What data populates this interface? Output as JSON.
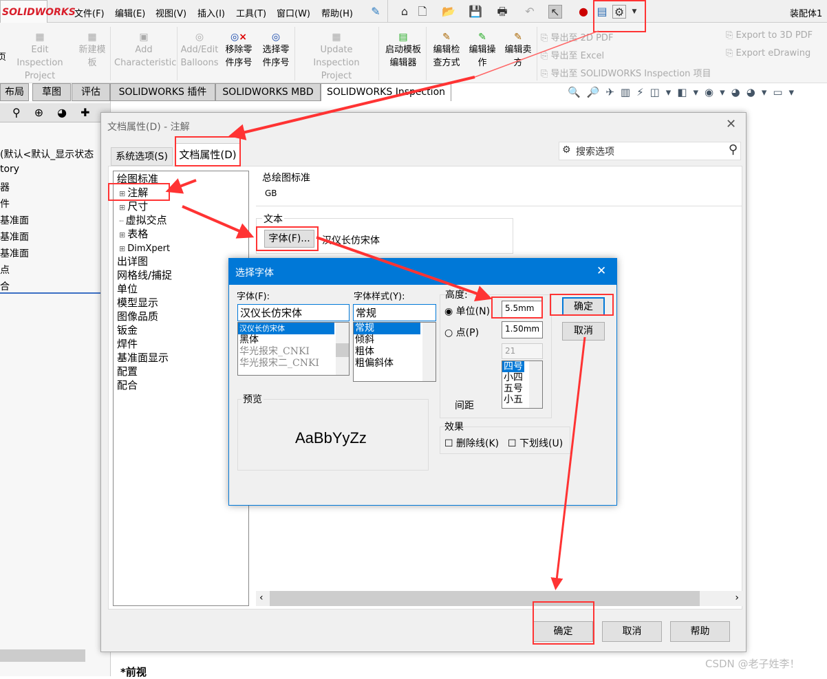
{
  "app": {
    "logo": "SOLIDWORKS",
    "doc_title": "装配体1"
  },
  "menu": [
    "文件(F)",
    "编辑(E)",
    "视图(V)",
    "插入(I)",
    "工具(T)",
    "窗口(W)",
    "帮助(H)"
  ],
  "ribbon": {
    "left_partial": "页",
    "items": [
      {
        "l1": "Edit Inspection",
        "l2": "Project",
        "enabled": false
      },
      {
        "l1": "新建模",
        "l2": "板",
        "enabled": false
      },
      {
        "l1": "Add",
        "l2": "Characteristic",
        "enabled": false
      },
      {
        "l1": "Add/Edit",
        "l2": "Balloons",
        "enabled": false
      },
      {
        "l1": "移除零",
        "l2": "件序号",
        "enabled": true
      },
      {
        "l1": "选择零",
        "l2": "件序号",
        "enabled": true
      },
      {
        "l1": "Update Inspection",
        "l2": "Project",
        "enabled": false
      },
      {
        "l1": "启动模板",
        "l2": "编辑器",
        "enabled": true
      },
      {
        "l1": "编辑检",
        "l2": "查方式",
        "enabled": true
      },
      {
        "l1": "编辑操",
        "l2": "作",
        "enabled": true
      },
      {
        "l1": "编辑卖",
        "l2": "方",
        "enabled": true
      }
    ],
    "exports": [
      "导出至 2D PDF",
      "导出至 Excel",
      "导出至 SOLIDWORKS Inspection 项目",
      "Export to 3D PDF",
      "Export eDrawing"
    ]
  },
  "tabs": [
    "布局",
    "草图",
    "评估",
    "SOLIDWORKS 插件",
    "SOLIDWORKS MBD",
    "SOLIDWORKS Inspection"
  ],
  "tree_left": [
    "(默认<默认_显示状态",
    "tory",
    "器",
    "件",
    "基准面",
    "基准面",
    "基准面",
    "点",
    "合"
  ],
  "view_label": "*前视",
  "docprops": {
    "title": "文档属性(D) - 注解",
    "tab_system": "系统选项(S)",
    "tab_doc": "文档属性(D)",
    "search_placeholder": "搜索选项",
    "tree": [
      {
        "label": "绘图标准",
        "level": 0
      },
      {
        "label": "注解",
        "level": 1,
        "exp": true
      },
      {
        "label": "尺寸",
        "level": 1,
        "exp": true
      },
      {
        "label": "虚拟交点",
        "level": 1
      },
      {
        "label": "表格",
        "level": 1,
        "exp": true
      },
      {
        "label": "DimXpert",
        "level": 1,
        "exp": true
      },
      {
        "label": "出详图",
        "level": 0
      },
      {
        "label": "网格线/捕捉",
        "level": 0
      },
      {
        "label": "单位",
        "level": 0
      },
      {
        "label": "模型显示",
        "level": 0
      },
      {
        "label": "图像品质",
        "level": 0
      },
      {
        "label": "钣金",
        "level": 0
      },
      {
        "label": "焊件",
        "level": 0
      },
      {
        "label": "基准面显示",
        "level": 0
      },
      {
        "label": "配置",
        "level": 0
      },
      {
        "label": "配合",
        "level": 0
      }
    ],
    "std_group": "总绘图标准",
    "std_value": "GB",
    "text_group": "文本",
    "font_btn": "字体(F)...",
    "font_name": "汉仪长仿宋体",
    "ok": "确定",
    "cancel": "取消",
    "help": "帮助"
  },
  "fontdlg": {
    "title": "选择字体",
    "font_label": "字体(F):",
    "font_value": "汉仪长仿宋体",
    "fonts": [
      "汉仪长仿宋体",
      "黑体",
      "华光报宋_CNKI",
      "华光报宋二_CNKI"
    ],
    "style_label": "字体样式(Y):",
    "style_value": "常规",
    "styles": [
      "常规",
      "倾斜",
      "粗体",
      "粗偏斜体"
    ],
    "height_label": "高度:",
    "unit_label": "单位(N)",
    "unit_value": "5.5mm",
    "point_label": "点(P)",
    "point_value": "1.50mm",
    "size_value": "21",
    "sizes": [
      "四号",
      "小四",
      "五号",
      "小五"
    ],
    "spacing_label": "间距",
    "preview_label": "预览",
    "preview_text": "AaBbYyZz",
    "effects_label": "效果",
    "strike": "删除线(K)",
    "underline": "下划线(U)",
    "ok": "确定",
    "cancel": "取消"
  },
  "watermark": "CSDN @老子姓李！",
  "colors": {
    "accent": "#0078d7",
    "annotation": "#f33"
  }
}
